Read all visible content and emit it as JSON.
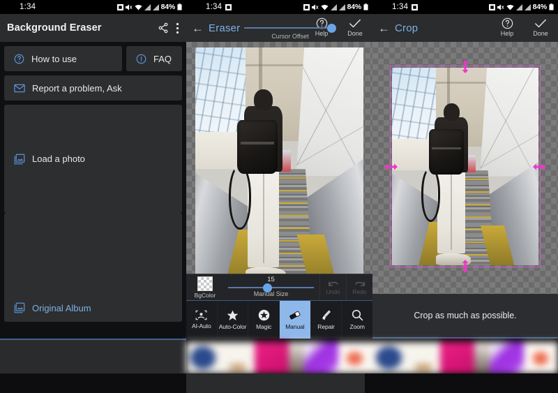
{
  "status_bar": {
    "time": "1:34",
    "battery_pct": "84%",
    "icons": [
      "screenshot-icon",
      "volume-off-icon",
      "wifi-icon",
      "signal-icon",
      "signal-icon",
      "battery-icon"
    ]
  },
  "colors": {
    "accent_blue": "#7fb0e5",
    "slider_blue": "#69a6e8",
    "tab_active_bg": "#8fb8ea",
    "crop_handle_magenta": "#ef35c8",
    "crop_border": "#d35bd3",
    "panel_bg": "#17181a",
    "appbar_bg": "#2b2c2e",
    "card_bg": "#2d2e30",
    "cursor_red": "#e03a3a"
  },
  "panel_home": {
    "appbar": {
      "title": "Background Eraser",
      "share_icon": "share-icon",
      "overflow_icon": "more-vertical-icon"
    },
    "menu": [
      {
        "label": "How to use",
        "icon": "help-circle-icon"
      },
      {
        "label": "FAQ",
        "icon": "info-circle-icon"
      },
      {
        "label": "Report a problem, Ask",
        "icon": "mail-icon"
      },
      {
        "label": "Load a photo",
        "icon": "image-icon"
      },
      {
        "label": "Original Album",
        "icon": "image-icon"
      }
    ]
  },
  "panel_eraser": {
    "header": {
      "back_icon": "arrow-left-icon",
      "title": "Eraser",
      "slider_caption": "Cursor Offset",
      "help_label": "Help",
      "help_icon": "help-circle-icon",
      "done_label": "Done",
      "done_icon": "check-icon"
    },
    "toolbar": {
      "bgcolor_label": "BgColor",
      "bgcolor_icon": "checkerboard-swatch",
      "manual_size_label": "Manual Size",
      "manual_size_value": "15",
      "undo_label": "Undo",
      "undo_icon": "undo-icon",
      "redo_label": "Redo",
      "redo_icon": "redo-icon"
    },
    "tabs": [
      {
        "label": "AI-Auto",
        "icon": "ai-face-icon",
        "active": false
      },
      {
        "label": "Auto-Color",
        "icon": "star-icon",
        "active": false
      },
      {
        "label": "Magic",
        "icon": "magic-star-icon",
        "active": false
      },
      {
        "label": "Manual",
        "icon": "eraser-icon",
        "active": true
      },
      {
        "label": "Repair",
        "icon": "brush-icon",
        "active": false
      },
      {
        "label": "Zoom",
        "icon": "search-icon",
        "active": false
      }
    ],
    "canvas": {
      "cursor_brush": "brush-ring-cursor",
      "cursor_dot": "red-dot-cursor",
      "photo_alt": "person-on-escalator-photo"
    }
  },
  "panel_crop": {
    "header": {
      "back_icon": "arrow-left-icon",
      "title": "Crop",
      "help_label": "Help",
      "help_icon": "help-circle-icon",
      "done_label": "Done",
      "done_icon": "check-icon"
    },
    "hint": "Crop as much as possible.",
    "crop_handles": [
      "top-handle",
      "bottom-handle",
      "left-handle",
      "right-handle"
    ]
  },
  "bottom_strip": {
    "name": "blurred-thumbnail-strip",
    "swatches": [
      "navy",
      "white",
      "pink",
      "thin",
      "purple",
      "coral",
      "navy",
      "white",
      "pink",
      "thin",
      "purple",
      "coral"
    ]
  }
}
